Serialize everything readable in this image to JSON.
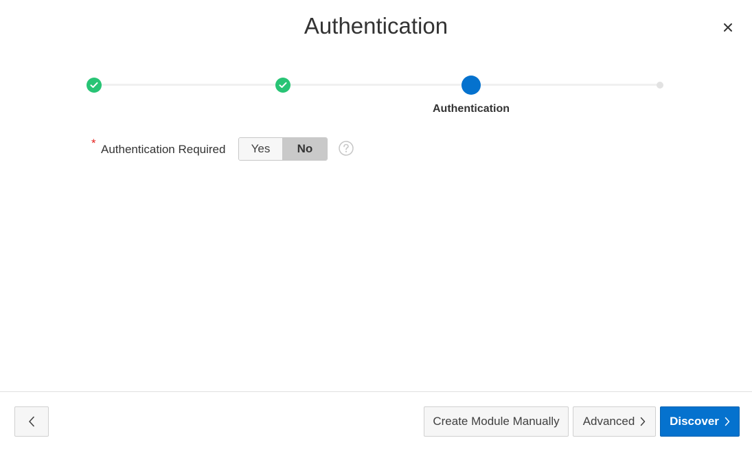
{
  "dialog": {
    "title": "Authentication",
    "close_icon": "close-icon"
  },
  "wizard": {
    "steps": [
      {
        "state": "complete",
        "label": ""
      },
      {
        "state": "complete",
        "label": ""
      },
      {
        "state": "current",
        "label": "Authentication"
      },
      {
        "state": "upcoming",
        "label": ""
      }
    ],
    "colors": {
      "complete": "#28c475",
      "current": "#0572ce",
      "upcoming": "#e2e2e2"
    }
  },
  "form": {
    "auth_required": {
      "required_mark": "*",
      "label": "Authentication Required",
      "options": [
        "Yes",
        "No"
      ],
      "selected": "No",
      "help_icon": "help-icon"
    }
  },
  "footer": {
    "back_icon": "chevron-left-icon",
    "create_module_label": "Create Module Manually",
    "advanced_label": "Advanced",
    "discover_label": "Discover",
    "primary_color": "#0572ce"
  }
}
